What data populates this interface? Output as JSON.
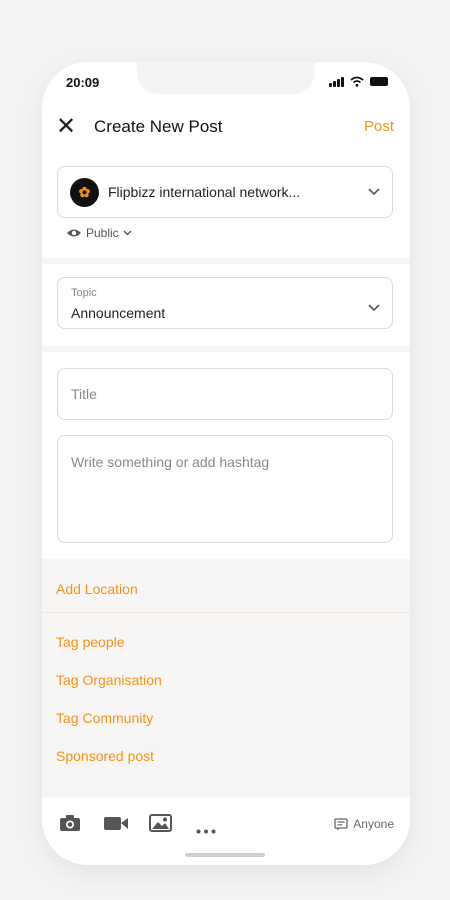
{
  "status_bar": {
    "time": "20:09"
  },
  "header": {
    "title": "Create New Post",
    "post_label": "Post"
  },
  "org": {
    "name": "Flipbizz international network..."
  },
  "visibility": {
    "label": "Public"
  },
  "topic": {
    "label": "Topic",
    "value": "Announcement"
  },
  "title_field": {
    "placeholder": "Title"
  },
  "body_field": {
    "placeholder": "Write something or add hashtag"
  },
  "options": {
    "add_location": "Add Location",
    "tag_people": "Tag people",
    "tag_organisation": "Tag Organisation",
    "tag_community": "Tag Community",
    "sponsored_post": "Sponsored post"
  },
  "bottom_bar": {
    "audience_label": "Anyone",
    "icons": [
      "camera-icon",
      "video-icon",
      "image-icon",
      "more-icon",
      "comment-icon"
    ]
  },
  "colors": {
    "accent": "#f0931d",
    "text": "#222222",
    "border": "#d9d9d9"
  }
}
